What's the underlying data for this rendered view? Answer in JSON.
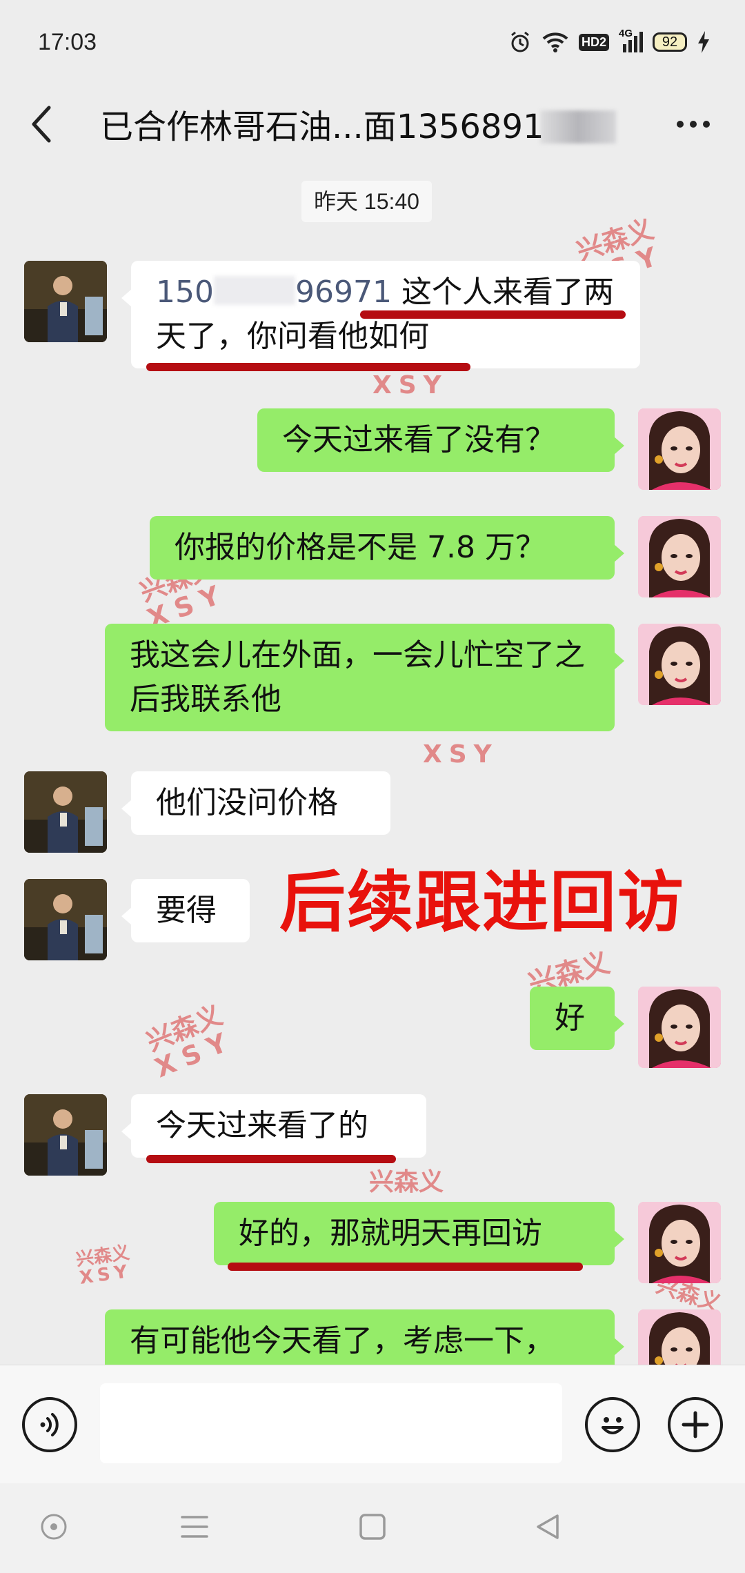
{
  "status_bar": {
    "time": "17:03",
    "hd_label": "HD2",
    "network_label": "4G",
    "battery": "92",
    "icons": [
      "alarm-icon",
      "wifi-icon",
      "hd-voice-icon",
      "signal-icon",
      "battery-icon",
      "charging-icon"
    ]
  },
  "header": {
    "back_icon": "chevron-left-icon",
    "title": "已合作林哥石油...面1356891",
    "more_icon": "more-dots-icon"
  },
  "chat": {
    "timestamp": "昨天 15:40",
    "messages": [
      {
        "side": "in",
        "phone_start": "150",
        "phone_end": "96971",
        "text_rest": " 这个人来看了两天了，你问看他如何"
      },
      {
        "side": "out",
        "text": "今天过来看了没有？"
      },
      {
        "side": "out",
        "text": "你报的价格是不是 7.8 万？"
      },
      {
        "side": "out",
        "text": "我这会儿在外面，一会儿忙空了之后我联系他"
      },
      {
        "side": "in",
        "text": "他们没问价格"
      },
      {
        "side": "in",
        "text": "要得"
      },
      {
        "side": "out",
        "text": "好"
      },
      {
        "side": "in",
        "text": "今天过来看了的"
      },
      {
        "side": "out",
        "text": "好的，那就明天再回访"
      },
      {
        "side": "out",
        "text": "有可能他今天看了，考虑一下，"
      }
    ],
    "overlay_caption": "后续跟进回访",
    "watermark_cn": "兴森义",
    "watermark_en": "XSY",
    "highlight_color": "#b50d12",
    "caption_color": "#e8120c"
  },
  "input_bar": {
    "voice_icon": "voice-input-icon",
    "placeholder": "",
    "emoji_icon": "emoji-icon",
    "plus_icon": "plus-icon"
  },
  "nav_bar": {
    "icons": [
      "home-circle-icon",
      "menu-lines-icon",
      "square-recents-icon",
      "back-triangle-icon"
    ]
  },
  "colors": {
    "background": "#ededed",
    "outgoing_bubble": "#95ec69",
    "incoming_bubble": "#ffffff"
  }
}
